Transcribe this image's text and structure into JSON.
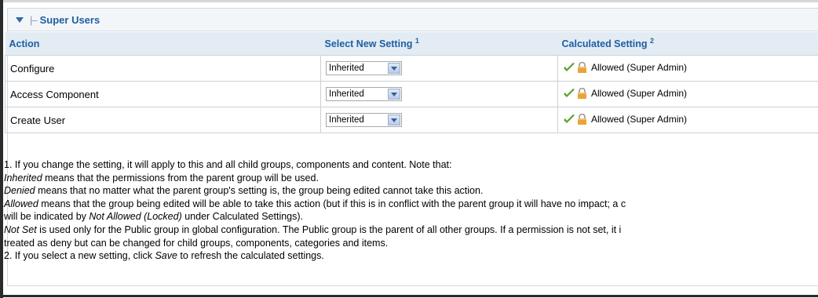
{
  "panel": {
    "title": "Super Users"
  },
  "table": {
    "headers": {
      "action": "Action",
      "select_new": "Select New Setting",
      "select_new_note": "1",
      "calculated": "Calculated Setting",
      "calculated_note": "2"
    },
    "rows": [
      {
        "action": "Configure",
        "setting": "Inherited",
        "calculated": "Allowed (Super Admin)"
      },
      {
        "action": "Access Component",
        "setting": "Inherited",
        "calculated": "Allowed (Super Admin)"
      },
      {
        "action": "Create User",
        "setting": "Inherited",
        "calculated": "Allowed (Super Admin)"
      }
    ]
  },
  "notes": {
    "line1": "1. If you change the setting, it will apply to this and all child groups, components and content. Note that:",
    "inherited_term": "Inherited",
    "inherited_text": " means that the permissions from the parent group will be used.",
    "denied_term": "Denied",
    "denied_text": " means that no matter what the parent group's setting is, the group being edited cannot take this action.",
    "allowed_term": "Allowed",
    "allowed_text": " means that the group being edited will be able to take this action (but if this is in conflict with the parent group it will have no impact; a c",
    "allowed_cont_pre": "will be indicated by ",
    "allowed_cont_term": "Not Allowed (Locked)",
    "allowed_cont_post": " under Calculated Settings).",
    "notset_term": "Not Set",
    "notset_text": " is used only for the Public group in global configuration. The Public group is the parent of all other groups. If a permission is not set, it i",
    "notset_cont": "treated as deny but can be changed for child groups, components, categories and items.",
    "line2_pre": "2. If you select a new setting, click ",
    "line2_term": "Save",
    "line2_post": " to refresh the calculated settings."
  },
  "colors": {
    "header_text": "#1d5fa4",
    "header_bg": "#e3ebf3",
    "check": "#5aa02c",
    "lock": "#e8a33a"
  },
  "icons": [
    "expand-arrow-icon",
    "check-icon",
    "lock-icon",
    "dropdown-arrow-icon"
  ]
}
